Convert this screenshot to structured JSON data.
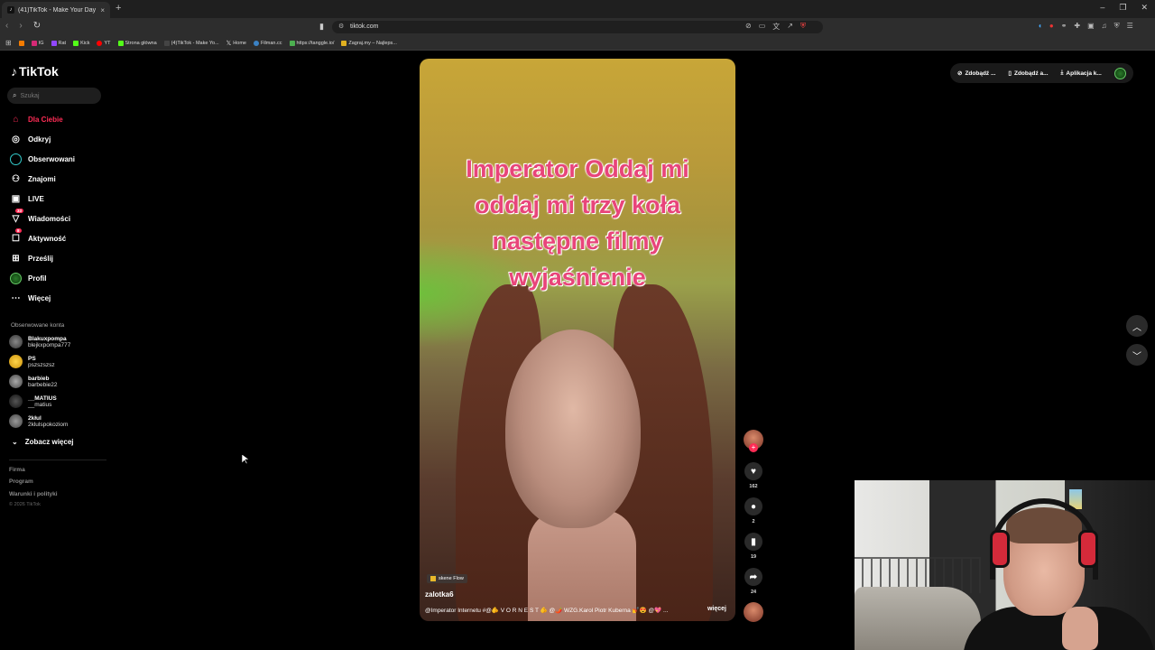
{
  "browser": {
    "tab_title": "(41)TikTok - Make Your Day",
    "tab_close": "×",
    "new_tab": "+",
    "window_controls": [
      "–",
      "❐",
      "✕"
    ],
    "url": "tiktok.com",
    "bookmarks": [
      {
        "label": "",
        "color": "#f57c00"
      },
      {
        "label": "IG",
        "color": "#d62976"
      },
      {
        "label": "Rat",
        "color": "#9147ff"
      },
      {
        "label": "Kick",
        "color": "#53fc18"
      },
      {
        "label": "YT",
        "color": "#ff0000"
      },
      {
        "label": "Strona główna",
        "color": "#53fc18"
      },
      {
        "label": "(4)TikTok - Make Yo...",
        "color": "#111111"
      },
      {
        "label": "Home",
        "color": "#000000"
      },
      {
        "label": "Filman.cc",
        "color": "#3b82c4"
      },
      {
        "label": "https://tanggle.io/",
        "color": "#4caf50"
      },
      {
        "label": "Zagraj.my – Najleps...",
        "color": "#e0b020"
      }
    ]
  },
  "sidebar": {
    "logo": "TikTok",
    "search_placeholder": "Szukaj",
    "nav": [
      {
        "label": "Dla Ciebie",
        "icon": "home-icon",
        "active": true,
        "badge": ""
      },
      {
        "label": "Odkryj",
        "icon": "compass-icon",
        "active": false,
        "badge": ""
      },
      {
        "label": "Obserwowani",
        "icon": "following-icon",
        "active": false,
        "badge": ""
      },
      {
        "label": "Znajomi",
        "icon": "friends-icon",
        "active": false,
        "badge": ""
      },
      {
        "label": "LIVE",
        "icon": "live-icon",
        "active": false,
        "badge": ""
      },
      {
        "label": "Wiadomości",
        "icon": "messages-icon",
        "active": false,
        "badge": "33"
      },
      {
        "label": "Aktywność",
        "icon": "activity-icon",
        "active": false,
        "badge": "8"
      },
      {
        "label": "Prześlij",
        "icon": "upload-icon",
        "active": false,
        "badge": ""
      },
      {
        "label": "Profil",
        "icon": "profile-icon",
        "active": false,
        "badge": ""
      },
      {
        "label": "Więcej",
        "icon": "more-icon",
        "active": false,
        "badge": ""
      }
    ],
    "followed_heading": "Obserwowane konta",
    "followed": [
      {
        "name": "Blakuxpompa",
        "handle": "blejkxpompa777"
      },
      {
        "name": "PS",
        "handle": "pszszszsz"
      },
      {
        "name": "barbieb",
        "handle": "barbebie22"
      },
      {
        "name": "__MATIUS",
        "handle": "__matius"
      },
      {
        "name": "2kłul",
        "handle": "2klulspokoziom"
      }
    ],
    "see_more": "Zobacz więcej",
    "footer": [
      "Firma",
      "Program",
      "Warunki i polityki"
    ],
    "copyright": "© 2026 TikTok"
  },
  "video": {
    "overlay_lines": [
      "Imperator Oddaj mi",
      "oddaj mi trzy koła",
      "następne filmy",
      "wyjaśnienie"
    ],
    "effect": "skene Flow",
    "author": "zalotka6",
    "description": "@Imperator Internetu #@🫵 V O R N E S T 🫵 @🌶️ WZG.Karol Piotr Kuberna 💅😍 @💖 ...",
    "more": "więcej"
  },
  "actions": {
    "likes": "162",
    "comments": "2",
    "saves": "19",
    "shares": "24"
  },
  "topright": {
    "btn1": "Zdobądź ...",
    "btn2": "Zdobądź a...",
    "btn3": "Aplikacja k..."
  }
}
